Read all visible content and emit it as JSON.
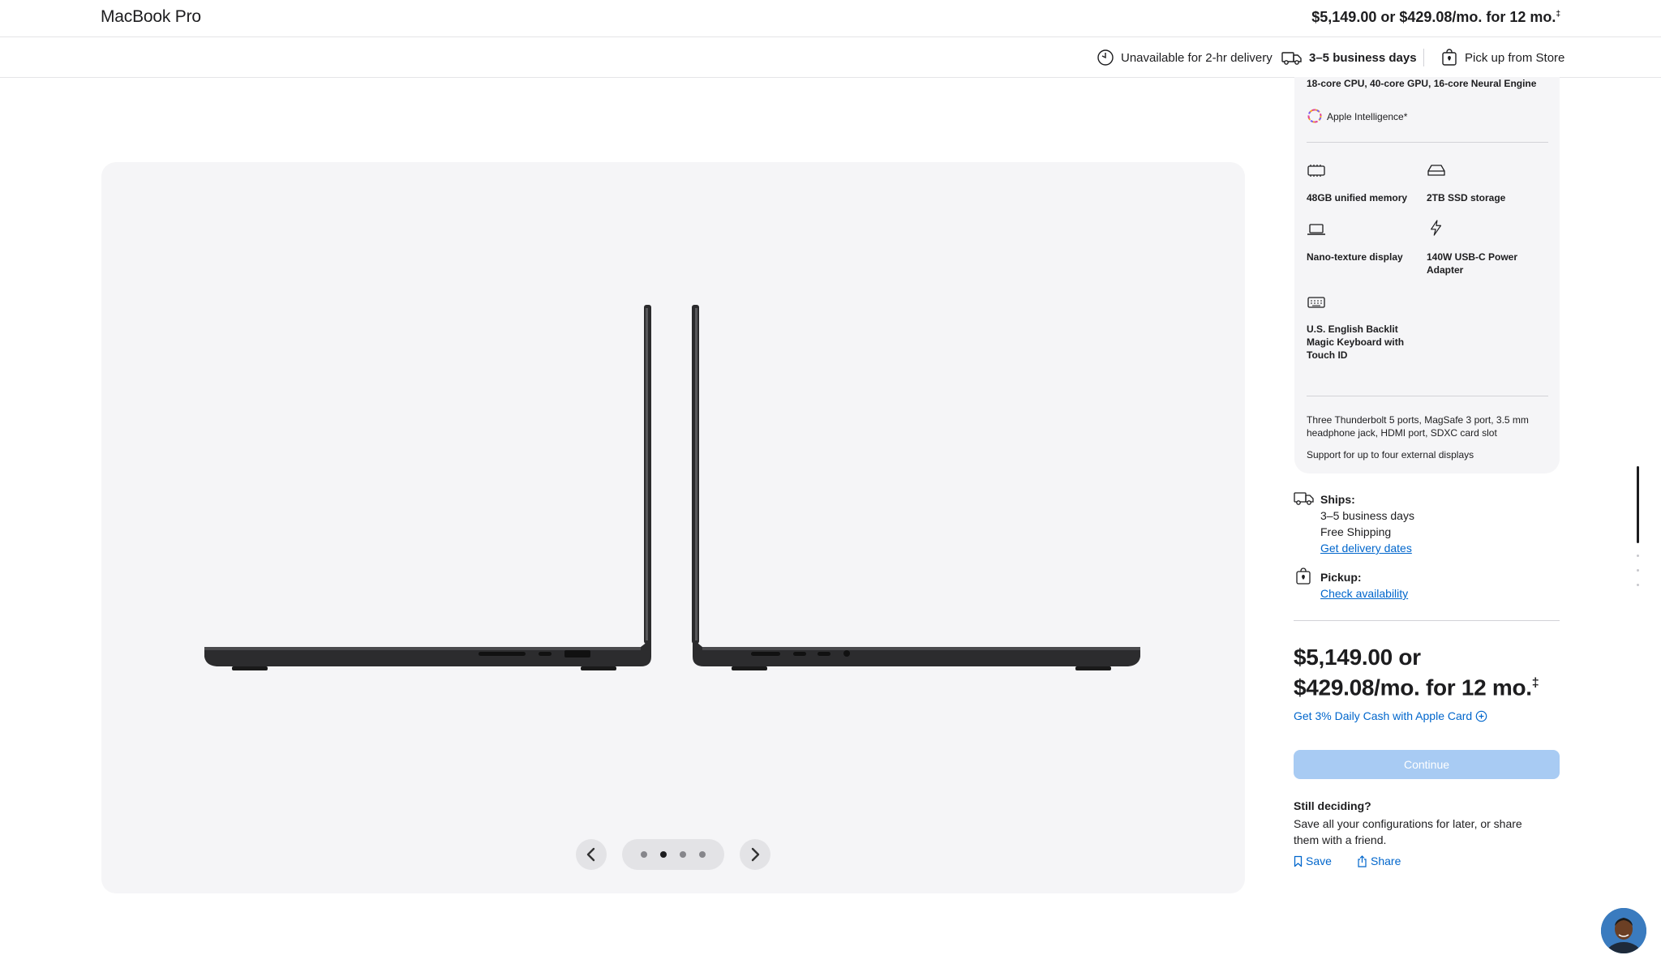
{
  "header": {
    "product_title": "MacBook Pro",
    "price": "$5,149.00 or $429.08/mo. for 12 mo.",
    "price_mark": "‡"
  },
  "delivery_bar": {
    "unavailable": "Unavailable for 2-hr delivery",
    "business_days": "3–5 business days",
    "pickup": "Pick up from Store"
  },
  "gallery": {
    "slides": 4,
    "active_slide": 2
  },
  "specs": {
    "chip_line": "18-core CPU, 40-core GPU, 16-core Neural Engine",
    "apple_intelligence": "Apple Intelligence*",
    "memory": "48GB unified memory",
    "storage": "2TB SSD storage",
    "display": "Nano-texture display",
    "power": "140W USB-C Power Adapter",
    "keyboard": "U.S. English Backlit Magic Keyboard with Touch ID",
    "ports": "Three Thunderbolt 5 ports, MagSafe 3 port, 3.5 mm headphone jack, HDMI port, SDXC card slot",
    "displays_support": "Support for up to four external displays"
  },
  "shipping": {
    "ships_label": "Ships:",
    "ships_days": "3–5 business days",
    "ships_free": "Free Shipping",
    "delivery_link": "Get delivery dates",
    "pickup_label": "Pickup:",
    "pickup_link": "Check availability"
  },
  "purchase": {
    "price_line1": "$5,149.00 or",
    "price_line2": "$429.08/mo. for 12 mo.",
    "price_mark": "‡",
    "apple_card": "Get 3% Daily Cash with Apple Card",
    "continue_label": "Continue",
    "still_title": "Still deciding?",
    "still_body": "Save all your configurations for later, or share them with a friend.",
    "save_label": "Save",
    "share_label": "Share"
  },
  "colors": {
    "accent_link": "#0066cc",
    "continue_disabled": "#a8cbf3",
    "panel_bg": "#f5f5f7",
    "text": "#1d1d1f"
  },
  "icons": [
    "timer-icon",
    "truck-icon",
    "store-bag-icon",
    "memory-chip-icon",
    "storage-drive-icon",
    "laptop-icon",
    "bolt-icon",
    "keyboard-icon",
    "plus-circle-icon",
    "bookmark-icon",
    "share-icon",
    "chevron-left-icon",
    "chevron-right-icon",
    "apple-intelligence-icon"
  ]
}
